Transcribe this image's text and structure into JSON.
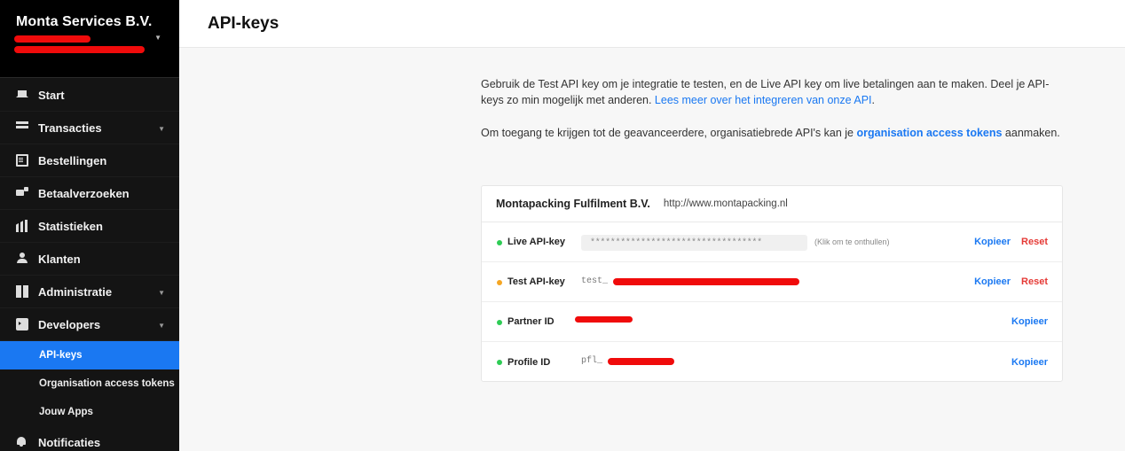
{
  "sidebar": {
    "org_name": "Monta Services B.V.",
    "items": [
      {
        "label": "Start",
        "icon": "home-icon"
      },
      {
        "label": "Transacties",
        "icon": "list-icon"
      },
      {
        "label": "Bestellingen",
        "icon": "document-icon"
      },
      {
        "label": "Betaalverzoeken",
        "icon": "payment-request-icon"
      },
      {
        "label": "Statistieken",
        "icon": "stats-icon"
      },
      {
        "label": "Klanten",
        "icon": "customers-icon"
      },
      {
        "label": "Administratie",
        "icon": "book-icon"
      },
      {
        "label": "Developers",
        "icon": "developer-icon"
      },
      {
        "label": "Notificaties",
        "icon": "bell-icon"
      }
    ],
    "developer_sub": [
      {
        "label": "API-keys",
        "active": true
      },
      {
        "label": "Organisation access tokens"
      },
      {
        "label": "Jouw Apps"
      }
    ]
  },
  "header": {
    "title": "API-keys"
  },
  "intro": {
    "p1_text": "Gebruik de Test API key om je integratie te testen, en de Live API key om live betalingen aan te maken. Deel je API-keys zo min mogelijk met anderen. ",
    "p1_link": "Lees meer over het integreren van onze API",
    "p1_end": ".",
    "p2_text": "Om toegang te krijgen tot de geavanceerdere, organisatiebrede API's kan je ",
    "p2_link": "organisation access tokens",
    "p2_end": " aanmaken."
  },
  "profile": {
    "name": "Montapacking Fulfilment B.V.",
    "url": "http://www.montapacking.nl",
    "rows": [
      {
        "label": "Live API-key",
        "status": "green",
        "masked": "**********************************",
        "reveal": "(Klik om te onthullen)",
        "copy": "Kopieer",
        "reset": "Reset"
      },
      {
        "label": "Test API-key",
        "status": "orange",
        "prefix": "test_",
        "copy": "Kopieer",
        "reset": "Reset"
      },
      {
        "label": "Partner ID",
        "status": "green",
        "copy": "Kopieer"
      },
      {
        "label": "Profile ID",
        "status": "green",
        "prefix": "pfl_",
        "copy": "Kopieer"
      }
    ]
  },
  "colors": {
    "accent": "#1a78f2",
    "reset": "#e53935",
    "sidebar_bg": "#141414",
    "live": "#2ecc55",
    "test": "#f5a623"
  }
}
